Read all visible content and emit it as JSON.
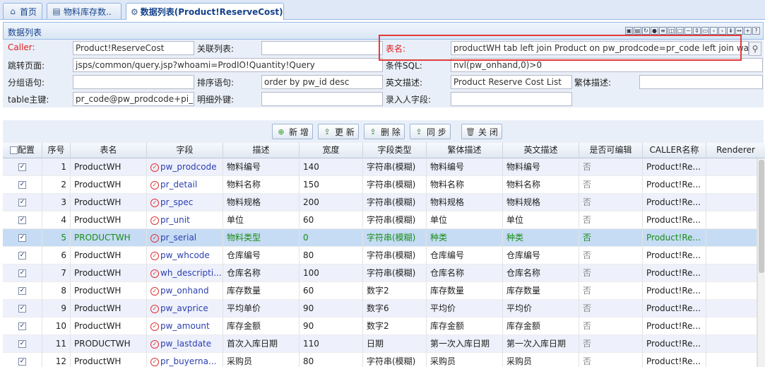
{
  "tabs": [
    {
      "label": "首页",
      "icon": "home-icon"
    },
    {
      "label": "物料库存数..",
      "icon": "document-icon"
    },
    {
      "label": "数据列表(Product!ReserveCost)",
      "icon": "gear-icon"
    }
  ],
  "panel": {
    "title": "数据列表"
  },
  "form": {
    "caller_label": "Caller:",
    "caller_value": "Product!ReserveCost",
    "related_list_label": "关联列表:",
    "related_list_value": "",
    "table_name_label": "表名:",
    "table_name_value": "productWH tab left join Product on pw_prodcode=pr_code left join wareh",
    "jump_page_label": "跳转页面:",
    "jump_page_value": "jsps/common/query.jsp?whoami=ProdIO!Quantity!Query",
    "condition_sql_label": "条件SQL:",
    "condition_sql_value": "nvl(pw_onhand,0)>0",
    "group_label": "分组语句:",
    "group_value": "",
    "order_label": "排序语句:",
    "order_value": "order by pw_id desc",
    "en_desc_label": "英文描述:",
    "en_desc_value": "Product Reserve Cost List",
    "tc_desc_label": "繁体描述:",
    "tc_desc_value": "",
    "table_pk_label": "table主键:",
    "table_pk_value": "pr_code@pw_prodcode+pi_w",
    "detail_fk_label": "明细外键:",
    "detail_fk_value": "",
    "recorder_label": "录入人字段:",
    "recorder_value": ""
  },
  "toolbar": {
    "add": "新 增",
    "update": "更 新",
    "delete": "删 除",
    "sync": "同 步",
    "close": "关 闭"
  },
  "grid": {
    "columns": [
      "配置",
      "序号",
      "表名",
      "字段",
      "描述",
      "宽度",
      "字段类型",
      "繁体描述",
      "英文描述",
      "是否可编辑",
      "CALLER名称",
      "Renderer"
    ],
    "rows": [
      {
        "no": "1",
        "table": "ProductWH",
        "field": "pw_prodcode",
        "desc": "物料编号",
        "width": "140",
        "type": "字符串(模糊)",
        "tc": "物料编号",
        "en": "物料编号",
        "editable": "否",
        "caller": "Product!Re..."
      },
      {
        "no": "2",
        "table": "ProductWH",
        "field": "pr_detail",
        "desc": "物料名称",
        "width": "150",
        "type": "字符串(模糊)",
        "tc": "物料名称",
        "en": "物料名称",
        "editable": "否",
        "caller": "Product!Re..."
      },
      {
        "no": "3",
        "table": "ProductWH",
        "field": "pr_spec",
        "desc": "物料规格",
        "width": "200",
        "type": "字符串(模糊)",
        "tc": "物料规格",
        "en": "物料规格",
        "editable": "否",
        "caller": "Product!Re..."
      },
      {
        "no": "4",
        "table": "ProductWH",
        "field": "pr_unit",
        "desc": "单位",
        "width": "60",
        "type": "字符串(模糊)",
        "tc": "单位",
        "en": "单位",
        "editable": "否",
        "caller": "Product!Re..."
      },
      {
        "no": "5",
        "table": "PRODUCTWH",
        "field": "pr_serial",
        "desc": "物料类型",
        "width": "0",
        "type": "字符串(模糊)",
        "tc": "种类",
        "en": "种类",
        "editable": "否",
        "caller": "Product!Re..."
      },
      {
        "no": "6",
        "table": "ProductWH",
        "field": "pw_whcode",
        "desc": "仓库编号",
        "width": "80",
        "type": "字符串(模糊)",
        "tc": "仓库编号",
        "en": "仓库编号",
        "editable": "否",
        "caller": "Product!Re..."
      },
      {
        "no": "7",
        "table": "ProductWH",
        "field": "wh_descripti...",
        "desc": "仓库名称",
        "width": "100",
        "type": "字符串(模糊)",
        "tc": "仓库名称",
        "en": "仓库名称",
        "editable": "否",
        "caller": "Product!Re..."
      },
      {
        "no": "8",
        "table": "ProductWH",
        "field": "pw_onhand",
        "desc": "库存数量",
        "width": "60",
        "type": "数字2",
        "tc": "库存数量",
        "en": "库存数量",
        "editable": "否",
        "caller": "Product!Re..."
      },
      {
        "no": "9",
        "table": "ProductWH",
        "field": "pw_avprice",
        "desc": "平均单价",
        "width": "90",
        "type": "数字6",
        "tc": "平均价",
        "en": "平均价",
        "editable": "否",
        "caller": "Product!Re..."
      },
      {
        "no": "10",
        "table": "ProductWH",
        "field": "pw_amount",
        "desc": "库存金额",
        "width": "90",
        "type": "数字2",
        "tc": "库存金额",
        "en": "库存金额",
        "editable": "否",
        "caller": "Product!Re..."
      },
      {
        "no": "11",
        "table": "PRODUCTWH",
        "field": "pw_lastdate",
        "desc": "首次入库日期",
        "width": "110",
        "type": "日期",
        "tc": "第一次入库日期",
        "en": "第一次入库日期",
        "editable": "否",
        "caller": "Product!Re..."
      },
      {
        "no": "12",
        "table": "ProductWH",
        "field": "pr_buyerna...",
        "desc": "采购员",
        "width": "80",
        "type": "字符串(模糊)",
        "tc": "采购员",
        "en": "采购员",
        "editable": "否",
        "caller": "Product!Re..."
      }
    ],
    "selected_row": "5"
  },
  "colors": {
    "accent": "#15428b",
    "selected_row": "#c6dcf4",
    "highlight_border": "#e23b3b",
    "selected_text": "#1a8c1a"
  }
}
